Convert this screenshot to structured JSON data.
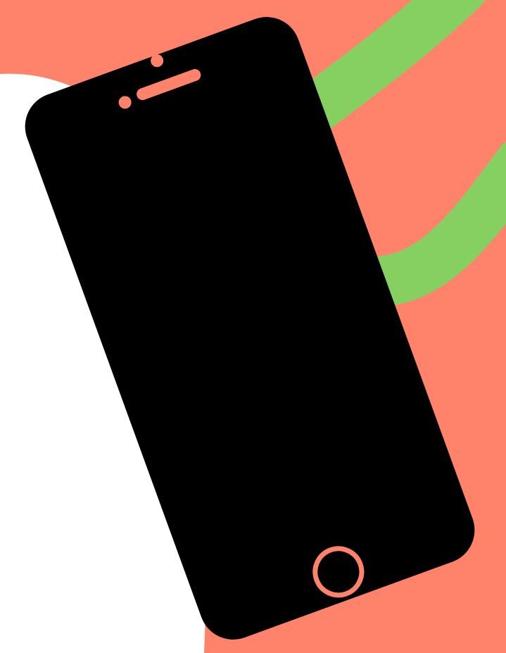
{
  "illustration": {
    "subject": "smartphone-icon",
    "colors": {
      "background": "#ffffff",
      "salmon": "#ff826b",
      "green": "#86d062",
      "phone_body": "#000000",
      "home_ring": "#ff826b"
    }
  }
}
